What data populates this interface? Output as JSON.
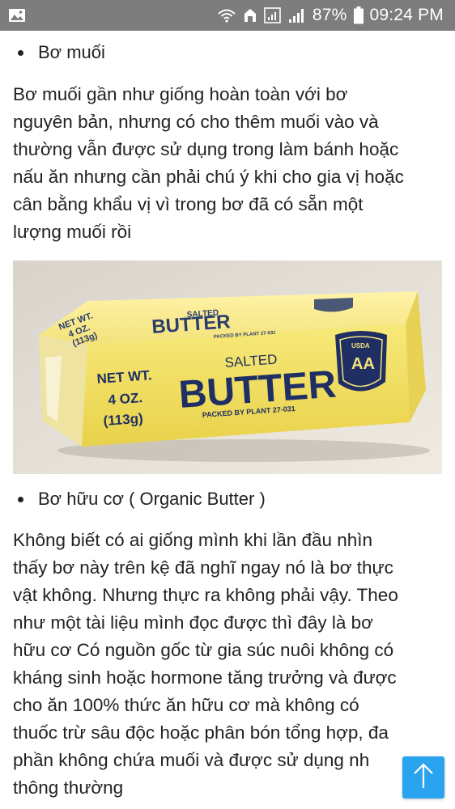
{
  "status_bar": {
    "battery": "87%",
    "time": "09:24 PM",
    "icons": [
      "image-icon",
      "wifi-icon",
      "sync-icon",
      "signal-icon",
      "signal-icon",
      "battery-icon"
    ]
  },
  "article": {
    "section1": {
      "bullet": "Bơ muối",
      "lines": [
        "Bơ muối gần như giống hoàn toàn với bơ",
        "nguyên bản, nhưng có cho thêm muối vào và",
        "thường vẫn được sử dụng trong làm bánh hoặc",
        "nấu ăn nhưng cần phải chú ý khi cho gia vị hoặc",
        "cân bằng khẩu vị vì trong bơ đã có sẵn một",
        "lượng muối rồi"
      ]
    },
    "image": {
      "top_label": {
        "line1": "NET WT.",
        "line2": "4 OZ.",
        "line3": "(113g)",
        "salted": "SALTED",
        "butter": "BUTTER",
        "packed": "PACKED BY PLANT 27-031"
      },
      "front_label": {
        "net": "NET WT.",
        "oz": "4 OZ.",
        "grams": "(113g)",
        "salted": "SALTED",
        "butter": "BUTTER",
        "packed": "PACKED BY PLANT 27-031"
      },
      "shield": {
        "usda": "USDA",
        "grade": "AA"
      }
    },
    "section2": {
      "bullet": "Bơ hữu cơ ( Organic Butter )",
      "lines": [
        "Không biết có ai giống mình khi lần đầu nhìn",
        "thấy bơ này trên kệ đã nghĩ ngay nó là bơ thực",
        "vật không. Nhưng thực ra không phải vậy. Theo",
        "như một tài liệu mình đọc được thì đây là bơ",
        "hữu cơ Có nguồn gốc từ gia súc nuôi không có",
        "kháng sinh hoặc hormone tăng trưởng và được",
        "cho ăn 100% thức ăn hữu cơ mà không có",
        "thuốc trừ sâu độc hoặc phân bón tổng hợp, đa",
        "phần không chứa muối và được sử dụng nh",
        "thông thường"
      ]
    }
  },
  "scroll_top_button": {
    "icon": "arrow-up-icon",
    "color": "#2aa3ef"
  },
  "colors": {
    "status_bar": "#7d7d7d",
    "text": "#222222"
  }
}
